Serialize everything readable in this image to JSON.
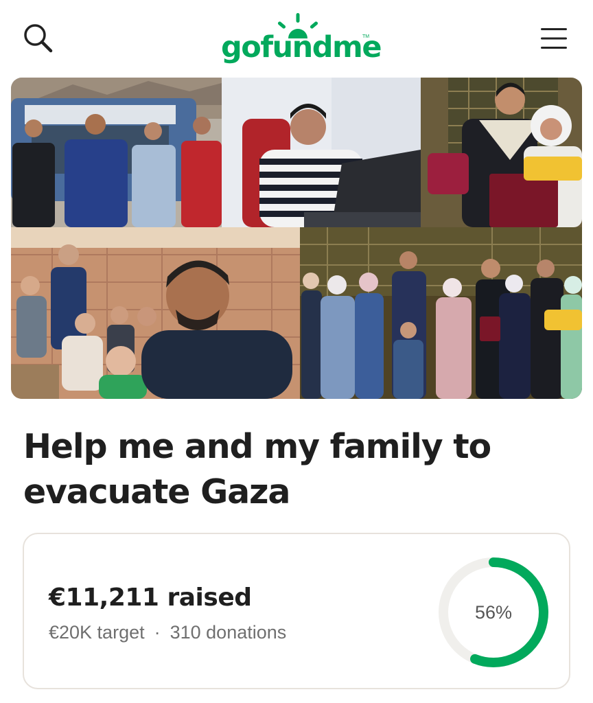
{
  "header": {
    "logo_text": "gofundme",
    "logo_tm": "TM",
    "search_icon": "search-icon",
    "menu_icon": "hamburger-menu-icon",
    "brand_color": "#02a95c"
  },
  "campaign": {
    "title": "Help me and my family to evacuate Gaza",
    "photo_count": 5
  },
  "progress": {
    "raised": "€11,211 raised",
    "target": "€20K target",
    "separator": "·",
    "donations": "310 donations",
    "percent_label": "56%",
    "fraction": 0.56,
    "ring_color": "#02a95c",
    "track_color": "#f0efec"
  }
}
